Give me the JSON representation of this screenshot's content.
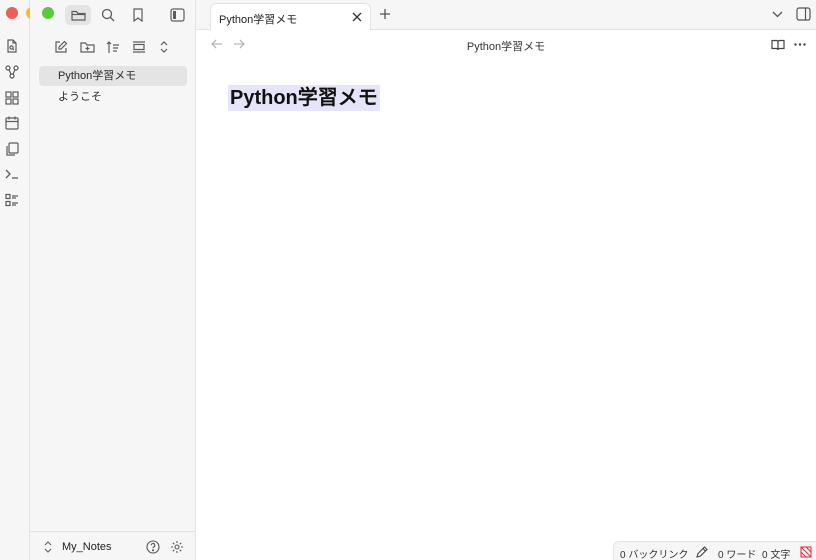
{
  "window": {
    "traffic_lights": {
      "close": "#ec5f57",
      "minimize": "#f4bd30",
      "zoom": "#5ac93d"
    }
  },
  "ribbon": {
    "icons": [
      "quick-switcher-icon",
      "graph-view-icon",
      "canvas-icon",
      "daily-note-icon",
      "templates-icon",
      "command-palette-icon",
      "outline-icon"
    ]
  },
  "sidebar": {
    "top_icons": [
      "folder-icon",
      "search-icon",
      "bookmark-icon",
      "sidebar-toggle-icon"
    ],
    "nav_buttons": [
      "new-note-icon",
      "new-folder-icon",
      "sort-icon",
      "auto-reveal-icon",
      "collapse-all-icon"
    ],
    "files": [
      {
        "name": "Python学習メモ",
        "active": true
      },
      {
        "name": "ようこそ",
        "active": false
      }
    ],
    "vault": {
      "name": "My_Notes"
    }
  },
  "tabs": [
    {
      "title": "Python学習メモ"
    }
  ],
  "editor": {
    "view_title": "Python学習メモ",
    "heading": "Python学習メモ"
  },
  "status_bar": {
    "backlinks": "0 バックリンク",
    "words": "0 ワード",
    "chars": "0 文字"
  },
  "colors": {
    "accent_highlight": "#e6e4f9",
    "sync_status": "#e93147"
  }
}
